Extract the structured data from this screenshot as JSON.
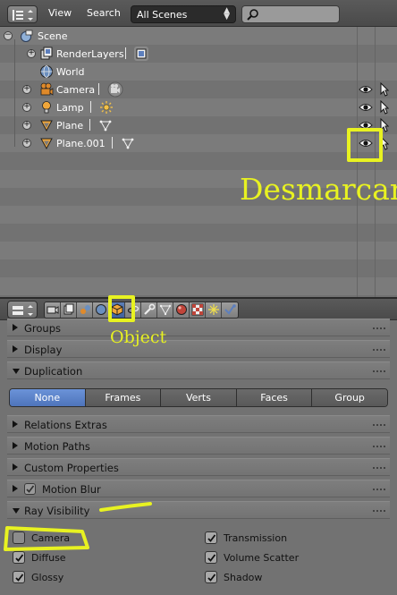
{
  "outliner": {
    "header": {
      "view": "View",
      "search": "Search",
      "display_mode": "All Scenes"
    },
    "tree": {
      "scene": "Scene",
      "render_layers": "RenderLayers",
      "world": "World",
      "objects": [
        {
          "name": "Camera",
          "data_icon": "camera-data-icon"
        },
        {
          "name": "Lamp",
          "data_icon": "lamp-data-icon"
        },
        {
          "name": "Plane",
          "data_icon": "mesh-data-icon"
        },
        {
          "name": "Plane.001",
          "data_icon": "mesh-data-icon"
        }
      ]
    }
  },
  "properties": {
    "context_tabs": [
      "render",
      "render-layers",
      "scene",
      "world",
      "object",
      "constraints",
      "modifiers",
      "data",
      "material",
      "texture",
      "particles",
      "physics"
    ],
    "active_tab": "object",
    "panels": {
      "groups": "Groups",
      "display": "Display",
      "duplication": "Duplication",
      "relations_extras": "Relations Extras",
      "motion_paths": "Motion Paths",
      "custom_properties": "Custom Properties",
      "motion_blur": "Motion Blur",
      "ray_visibility": "Ray Visibility"
    },
    "duplication_modes": [
      "None",
      "Frames",
      "Verts",
      "Faces",
      "Group"
    ],
    "duplication_selected": "None",
    "ray_visibility": {
      "camera": {
        "label": "Camera",
        "checked": false
      },
      "diffuse": {
        "label": "Diffuse",
        "checked": true
      },
      "glossy": {
        "label": "Glossy",
        "checked": true
      },
      "transmission": {
        "label": "Transmission",
        "checked": true
      },
      "volume_scatter": {
        "label": "Volume Scatter",
        "checked": true
      },
      "shadow": {
        "label": "Shadow",
        "checked": true
      }
    }
  },
  "annotations": {
    "desmarcar": "Desmarcar",
    "object": "Object"
  },
  "colors": {
    "annotation": "#e8f221",
    "selection": "#5680c2"
  }
}
